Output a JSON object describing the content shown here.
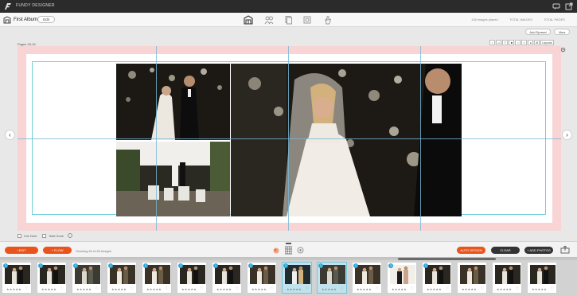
{
  "app": {
    "name": "FUNDY DESIGNER"
  },
  "album": {
    "title": "First Album",
    "edit_label": "Edit"
  },
  "header_stats": {
    "images_placed": "138 images placed",
    "total_images": "TOTAL IMAGES",
    "total_pages": "TOTAL PAGES"
  },
  "workspace": {
    "add_spread_label": "Add Spread",
    "view_label": "View",
    "pages_label": "Pages 33-34",
    "mini_tools": [
      "↕",
      "▭",
      "T",
      "■",
      "▪",
      "◐",
      "●",
      "⊞",
      "Layouts"
    ],
    "cut_zone_label": "Cut Zone",
    "safe_zone_label": "Safe Zone"
  },
  "bottom_toolbar": {
    "edit_label": "EDIT",
    "flow_label": "FLOW",
    "showing_text": "Showing 63 of 63 images",
    "auto_design_label": "AUTO DESIGN",
    "clear_label": "CLEAR",
    "add_photos_label": "+ ADD PHOTOS"
  },
  "filmstrip": {
    "thumbnails": [
      {
        "badge": "3",
        "selected": false,
        "scene": "couple"
      },
      {
        "badge": "1",
        "selected": false,
        "scene": "couple"
      },
      {
        "badge": "3",
        "selected": false,
        "scene": "group"
      },
      {
        "badge": "1",
        "selected": false,
        "scene": "venue"
      },
      {
        "badge": "2",
        "selected": false,
        "scene": "venue"
      },
      {
        "badge": "3",
        "selected": false,
        "scene": "couple"
      },
      {
        "badge": "1",
        "selected": false,
        "scene": "couple"
      },
      {
        "badge": "2",
        "selected": false,
        "scene": "venue"
      },
      {
        "badge": "2",
        "selected": true,
        "scene": "bride"
      },
      {
        "badge": "1",
        "selected": true,
        "scene": "group"
      },
      {
        "badge": "2",
        "selected": false,
        "scene": "venue"
      },
      {
        "badge": "3",
        "selected": false,
        "scene": "portrait"
      },
      {
        "badge": "1",
        "selected": false,
        "scene": "couple"
      },
      {
        "badge": "",
        "selected": false,
        "scene": "venue"
      },
      {
        "badge": "",
        "selected": false,
        "scene": "couple"
      },
      {
        "badge": "",
        "selected": false,
        "scene": "couple"
      }
    ]
  },
  "colors": {
    "accent_orange": "#e9541d",
    "selection_blue": "#2aa5d6",
    "bleed_pink": "#f8d4d4",
    "guide_cyan": "#6fd0d8"
  }
}
